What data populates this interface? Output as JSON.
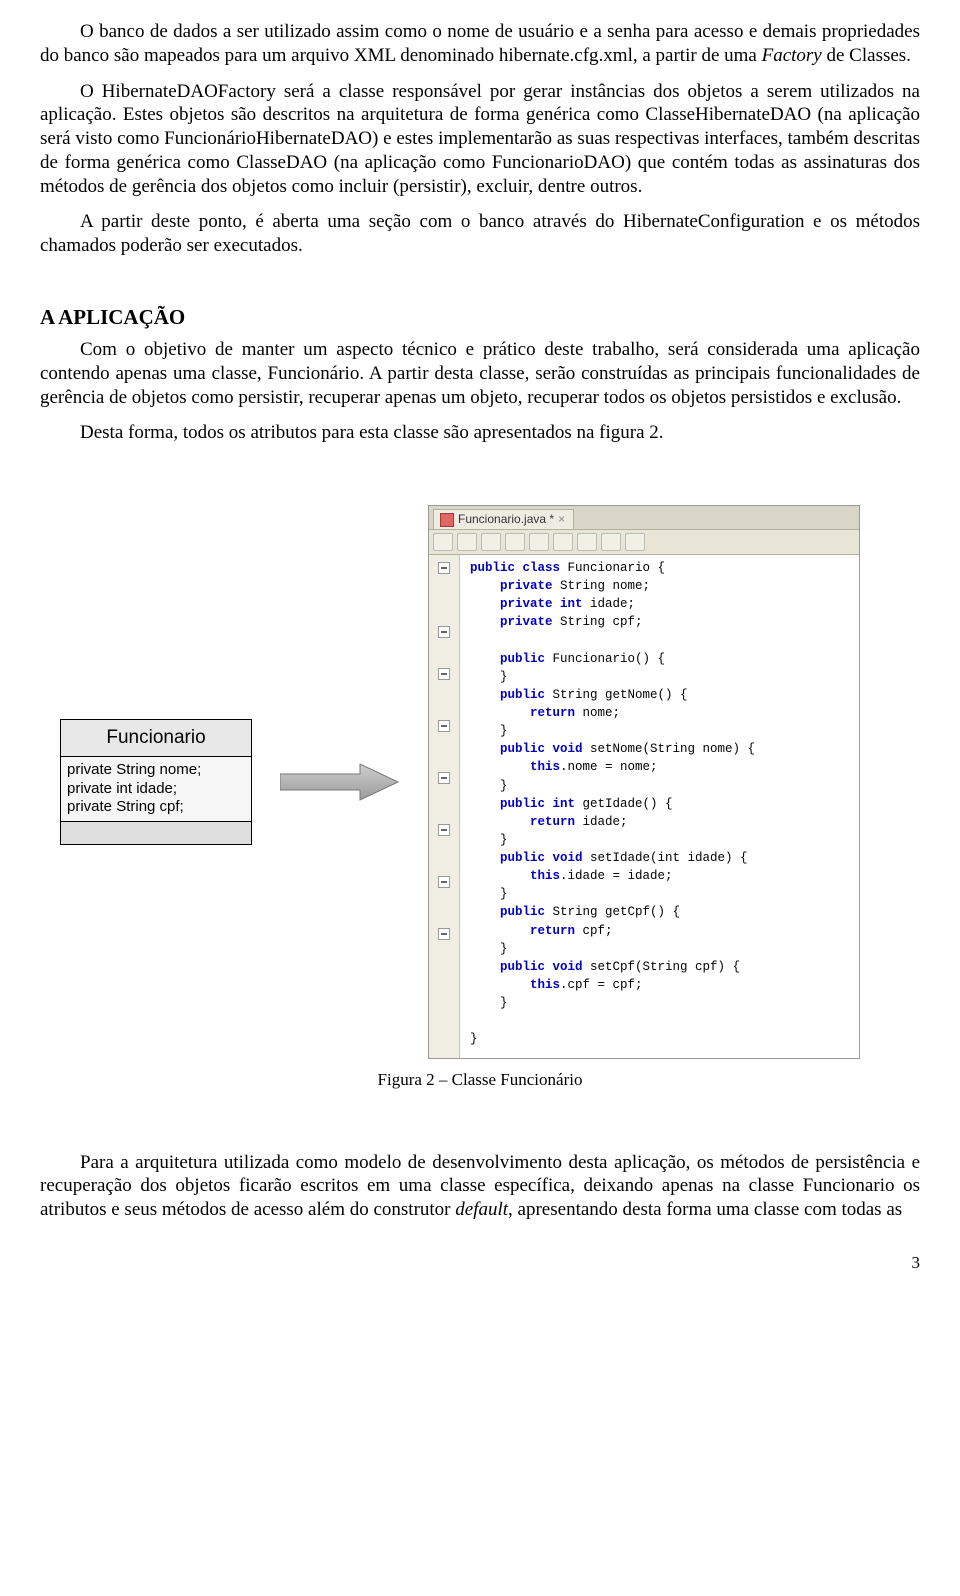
{
  "paragraphs": {
    "p1_a": "O banco de dados a ser utilizado assim como o nome de usuário e a senha para acesso e demais propriedades do banco são mapeados para um arquivo XML denominado hibernate.cfg.xml, a partir de uma ",
    "p1_b": "Factory",
    "p1_c": " de Classes.",
    "p2": "O HibernateDAOFactory será a classe responsável por gerar instâncias dos objetos a serem utilizados na aplicação. Estes objetos são descritos na arquitetura de forma genérica como ClasseHibernateDAO (na aplicação será visto como FuncionárioHibernateDAO) e estes implementarão as suas respectivas interfaces, também descritas de forma genérica como ClasseDAO (na aplicação como FuncionarioDAO) que contém todas as assinaturas dos métodos de gerência dos objetos como incluir (persistir), excluir, dentre outros.",
    "p3": "A partir deste ponto, é aberta uma seção com o banco através do HibernateConfiguration e os métodos chamados poderão ser executados.",
    "p4": "Com o objetivo de manter um aspecto técnico e prático deste trabalho, será considerada uma aplicação contendo apenas uma classe, Funcionário. A partir desta classe, serão construídas as principais funcionalidades de gerência de objetos como persistir, recuperar apenas um objeto, recuperar todos os objetos persistidos e exclusão.",
    "p5": "Desta forma, todos os atributos para esta classe são apresentados na figura 2.",
    "p6_a": "Para a arquitetura utilizada como modelo de desenvolvimento desta aplicação, os métodos de persistência e recuperação dos objetos ficarão escritos em uma classe específica, deixando apenas na classe Funcionario os atributos e seus métodos de acesso além do construtor ",
    "p6_b": "default",
    "p6_c": ", apresentando desta forma uma classe com todas as"
  },
  "section_heading": "A APLICAÇÃO",
  "uml": {
    "title": "Funcionario",
    "attr1": "private String nome;",
    "attr2": "private int idade;",
    "attr3": "private String cpf;"
  },
  "ide": {
    "tab_label": "Funcionario.java *",
    "code": {
      "l1a": "public class",
      "l1b": " Funcionario {",
      "l2a": "    private",
      "l2b": " String nome;",
      "l3a": "    private int",
      "l3b": " idade;",
      "l4a": "    private",
      "l4b": " String cpf;",
      "l5a": "    public",
      "l5b": " Funcionario() {",
      "l6": "    }",
      "l7a": "    public",
      "l7b": " String getNome() {",
      "l8a": "        return",
      "l8b": " nome;",
      "l9": "    }",
      "l10a": "    public void",
      "l10b": " setNome(String nome) {",
      "l11a": "        this",
      "l11b": ".nome = nome;",
      "l12": "    }",
      "l13a": "    public int",
      "l13b": " getIdade() {",
      "l14a": "        return",
      "l14b": " idade;",
      "l15": "    }",
      "l16a": "    public void",
      "l16b": " setIdade(int idade) {",
      "l17a": "        this",
      "l17b": ".idade = idade;",
      "l18": "    }",
      "l19a": "    public",
      "l19b": " String getCpf() {",
      "l20a": "        return",
      "l20b": " cpf;",
      "l21": "    }",
      "l22a": "    public void",
      "l22b": " setCpf(String cpf) {",
      "l23a": "        this",
      "l23b": ".cpf = cpf;",
      "l24": "    }",
      "l25": "}"
    }
  },
  "figure_caption": "Figura 2 – Classe Funcionário",
  "page_number": "3"
}
